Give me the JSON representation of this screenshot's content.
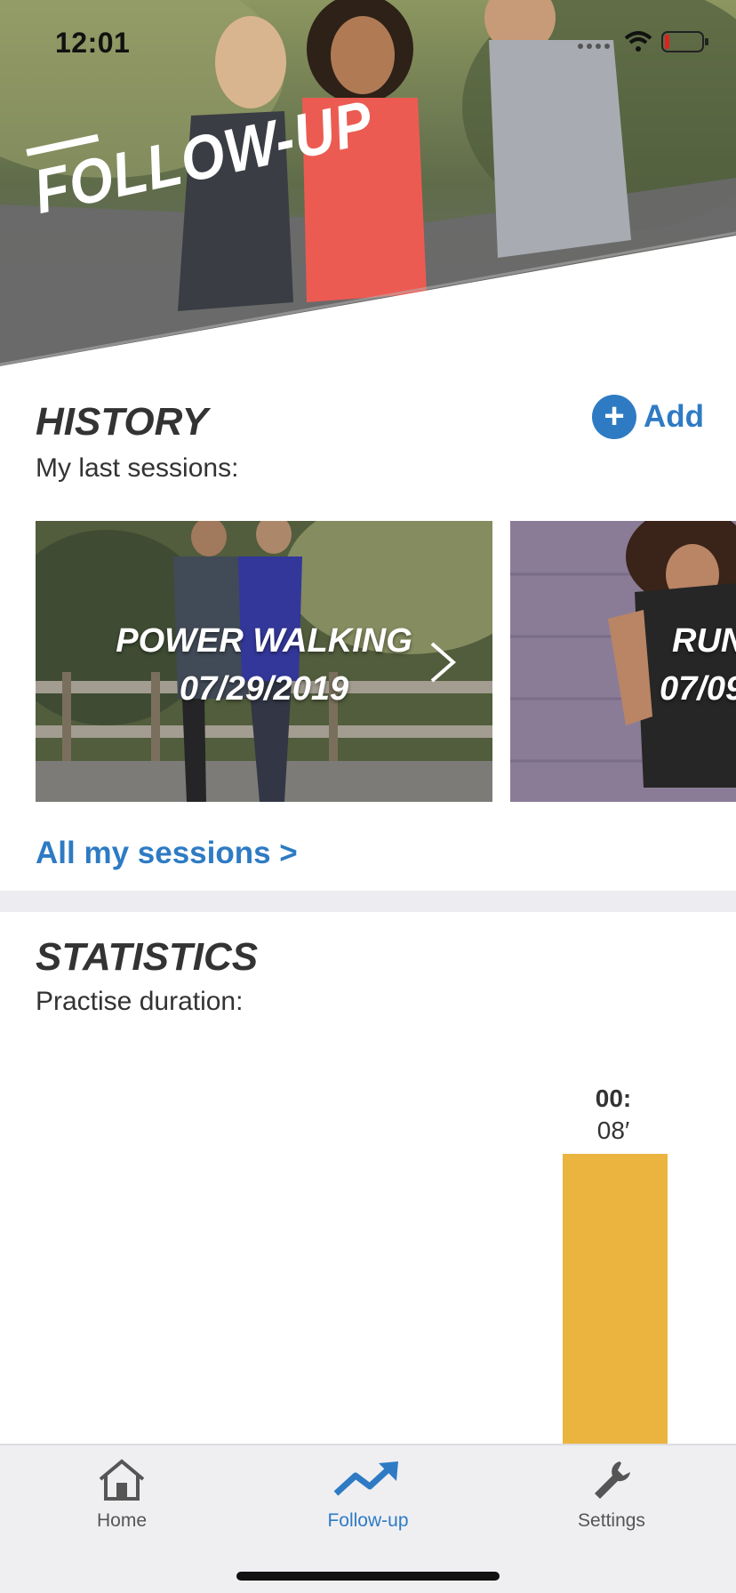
{
  "status_bar": {
    "time": "12:01",
    "battery_level": 0.12
  },
  "hero": {
    "title": "FOLLOW-UP"
  },
  "history": {
    "title": "HISTORY",
    "subtitle": "My last sessions:",
    "add_label": "Add",
    "cards": [
      {
        "activity": "POWER WALKING",
        "date": "07/29/2019"
      },
      {
        "activity": "RUN",
        "date": "07/09"
      }
    ],
    "all_sessions_link": "All my sessions >"
  },
  "statistics": {
    "title": "STATISTICS",
    "subtitle": "Practise duration:",
    "bar_value_line1": "00:",
    "bar_value_line2": "08′",
    "bar_color": "#eab43f"
  },
  "tabbar": {
    "items": [
      {
        "label": "Home",
        "icon": "home-icon",
        "active": false
      },
      {
        "label": "Follow-up",
        "icon": "trend-up-icon",
        "active": true
      },
      {
        "label": "Settings",
        "icon": "wrench-icon",
        "active": false
      }
    ]
  },
  "colors": {
    "accent": "#2e7bc4",
    "bar": "#eab43f",
    "text": "#333333"
  }
}
